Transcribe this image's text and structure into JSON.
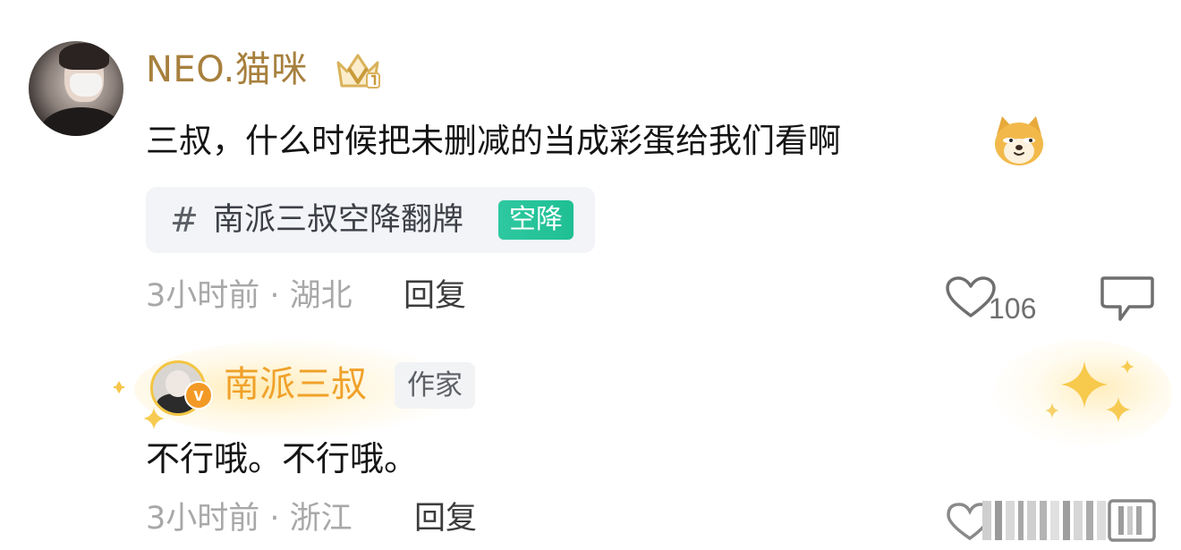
{
  "comment": {
    "username": "NEO.猫咪",
    "badge_icon": "crown-badge-icon",
    "text": "三叔，什么时候把未删减的当成彩蛋给我们看啊",
    "emoji_icon": "doge-emoji-icon",
    "topic": {
      "hash": "#",
      "name": "南派三叔空降翻牌",
      "tag": "空降"
    },
    "meta": "3小时前 · 湖北",
    "reply_label": "回复",
    "like_count": "106",
    "colors": {
      "username": "#a7803e",
      "topic_tag": "#1fbf94"
    }
  },
  "reply": {
    "username": "南派三叔",
    "verified_badge": "v",
    "author_tag": "作家",
    "text": "不行哦。不行哦。",
    "meta": "3小时前 · 浙江",
    "reply_label": "回复",
    "colors": {
      "username": "#f0a12a",
      "verified": "#f39a26"
    }
  }
}
